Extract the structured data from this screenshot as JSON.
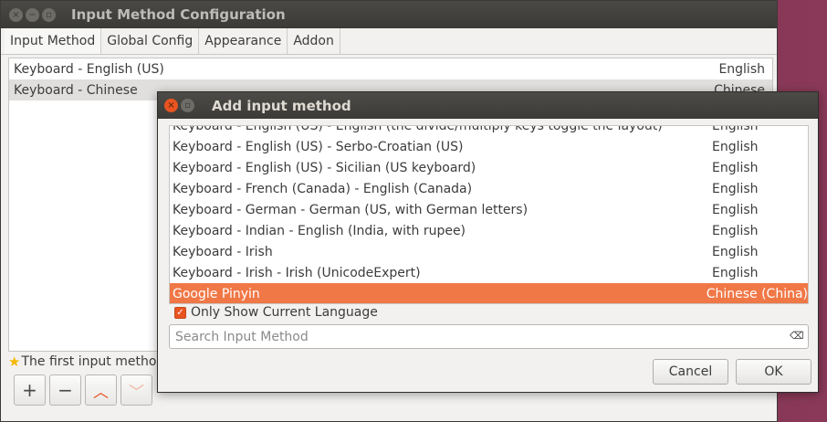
{
  "window": {
    "title": "Input Method Configuration",
    "close_glyph": "×",
    "min_glyph": "−",
    "max_glyph": "▫"
  },
  "tabs": [
    "Input Method",
    "Global Config",
    "Appearance",
    "Addon"
  ],
  "input_methods": [
    {
      "name": "Keyboard - English (US)",
      "lang": "English"
    },
    {
      "name": "Keyboard - Chinese",
      "lang": "Chinese"
    }
  ],
  "hint": "The first input method",
  "toolbar": {
    "add": "+",
    "remove": "−",
    "up": "︿",
    "down": "﹀"
  },
  "dialog": {
    "title": "Add input method",
    "close_glyph": "×",
    "max_glyph": "▫",
    "rows": [
      {
        "name": "Keyboard - English (US) - English (the divide/multiply keys toggle the layout)",
        "lang": "English"
      },
      {
        "name": "Keyboard - English (US) - Serbo-Croatian (US)",
        "lang": "English"
      },
      {
        "name": "Keyboard - English (US) - Sicilian (US keyboard)",
        "lang": "English"
      },
      {
        "name": "Keyboard - French (Canada) - English (Canada)",
        "lang": "English"
      },
      {
        "name": "Keyboard - German - German (US, with German letters)",
        "lang": "English"
      },
      {
        "name": "Keyboard - Indian - English (India, with rupee)",
        "lang": "English"
      },
      {
        "name": "Keyboard - Irish",
        "lang": "English"
      },
      {
        "name": "Keyboard - Irish - Irish (UnicodeExpert)",
        "lang": "English"
      },
      {
        "name": "Google Pinyin",
        "lang": "Chinese (China)"
      }
    ],
    "only_show_label": "Only Show Current Language",
    "search_placeholder": "Search Input Method",
    "cancel_label": "Cancel",
    "ok_label": "OK"
  },
  "colors": {
    "accent": "#e95420",
    "selection": "#f07746"
  }
}
